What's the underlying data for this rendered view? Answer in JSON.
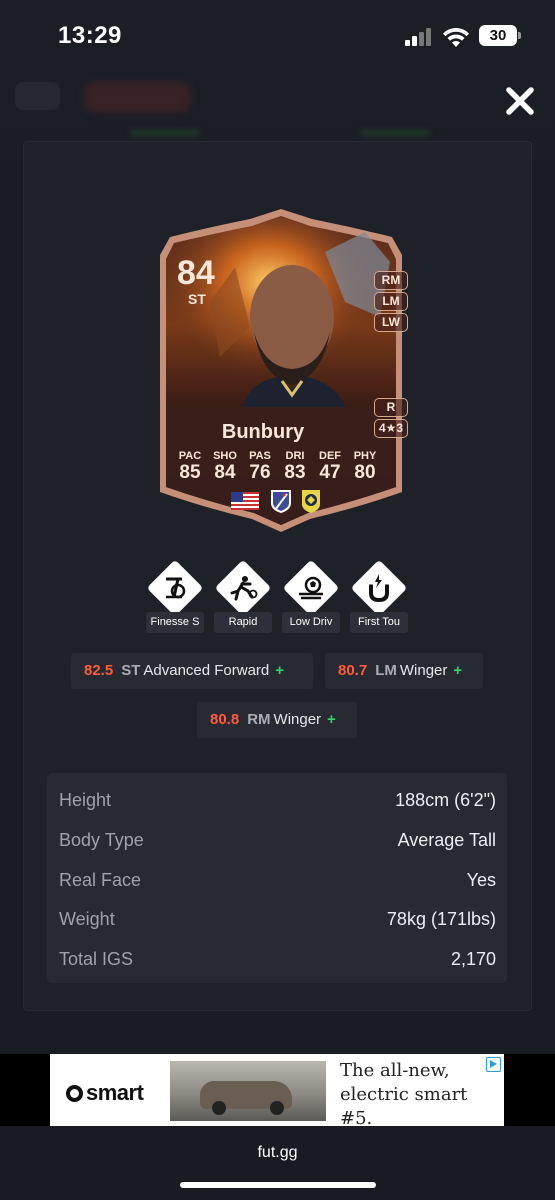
{
  "status_bar": {
    "time": "13:29",
    "battery": "30",
    "icons": [
      "signal-icon",
      "wifi-icon",
      "battery-icon"
    ]
  },
  "close_icon": "close-icon",
  "player_card": {
    "rating": "84",
    "position": "ST",
    "name": "Bunbury",
    "alt_positions": [
      "RM",
      "LM",
      "LW"
    ],
    "preferred_foot": "R",
    "skill_weak_foot": "4★3",
    "stats": [
      {
        "label": "PAC",
        "value": "85"
      },
      {
        "label": "SHO",
        "value": "84"
      },
      {
        "label": "PAS",
        "value": "76"
      },
      {
        "label": "DRI",
        "value": "83"
      },
      {
        "label": "DEF",
        "value": "47"
      },
      {
        "label": "PHY",
        "value": "80"
      }
    ],
    "badges": [
      "usa-flag-icon",
      "mls-league-icon",
      "nashville-club-icon"
    ]
  },
  "playstyles": [
    {
      "label": "Finesse S",
      "icon": "finesse-shot-icon"
    },
    {
      "label": "Rapid",
      "icon": "rapid-icon"
    },
    {
      "label": "Low Driv",
      "icon": "low-driven-shot-icon"
    },
    {
      "label": "First Tou",
      "icon": "first-touch-icon"
    }
  ],
  "roles": [
    {
      "rating": "82.5",
      "position": "ST",
      "name": "Advanced Forward",
      "plus": "+"
    },
    {
      "rating": "80.7",
      "position": "LM",
      "name": "Winger",
      "plus": "+"
    },
    {
      "rating": "80.8",
      "position": "RM",
      "name": "Winger",
      "plus": "+"
    }
  ],
  "info": [
    {
      "label": "Height",
      "value": "188cm (6'2\")"
    },
    {
      "label": "Body Type",
      "value": "Average Tall"
    },
    {
      "label": "Real Face",
      "value": "Yes"
    },
    {
      "label": "Weight",
      "value": "78kg (171lbs)"
    },
    {
      "label": "Total IGS",
      "value": "2,170"
    }
  ],
  "ad": {
    "brand": "smart",
    "text": "The all-new, electric smart #5.",
    "badge_icon": "adchoices-icon"
  },
  "browser": {
    "url": "fut.gg"
  },
  "colors": {
    "background": "#1a1c24",
    "panel": "#1f2129",
    "row": "#272a33",
    "accent_rating": "#ff5b3a",
    "accent_plus": "#38d26a",
    "card_text": "#fbe8d8"
  }
}
